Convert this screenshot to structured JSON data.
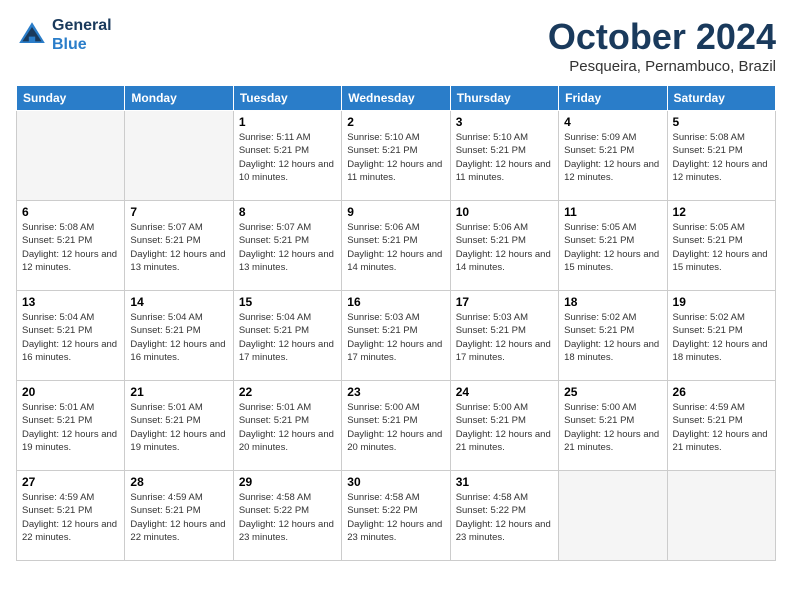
{
  "header": {
    "logo_line1": "General",
    "logo_line2": "Blue",
    "month": "October 2024",
    "location": "Pesqueira, Pernambuco, Brazil"
  },
  "weekdays": [
    "Sunday",
    "Monday",
    "Tuesday",
    "Wednesday",
    "Thursday",
    "Friday",
    "Saturday"
  ],
  "weeks": [
    [
      {
        "day": "",
        "sunrise": "",
        "sunset": "",
        "daylight": "",
        "empty": true
      },
      {
        "day": "",
        "sunrise": "",
        "sunset": "",
        "daylight": "",
        "empty": true
      },
      {
        "day": "1",
        "sunrise": "Sunrise: 5:11 AM",
        "sunset": "Sunset: 5:21 PM",
        "daylight": "Daylight: 12 hours and 10 minutes.",
        "empty": false
      },
      {
        "day": "2",
        "sunrise": "Sunrise: 5:10 AM",
        "sunset": "Sunset: 5:21 PM",
        "daylight": "Daylight: 12 hours and 11 minutes.",
        "empty": false
      },
      {
        "day": "3",
        "sunrise": "Sunrise: 5:10 AM",
        "sunset": "Sunset: 5:21 PM",
        "daylight": "Daylight: 12 hours and 11 minutes.",
        "empty": false
      },
      {
        "day": "4",
        "sunrise": "Sunrise: 5:09 AM",
        "sunset": "Sunset: 5:21 PM",
        "daylight": "Daylight: 12 hours and 12 minutes.",
        "empty": false
      },
      {
        "day": "5",
        "sunrise": "Sunrise: 5:08 AM",
        "sunset": "Sunset: 5:21 PM",
        "daylight": "Daylight: 12 hours and 12 minutes.",
        "empty": false
      }
    ],
    [
      {
        "day": "6",
        "sunrise": "Sunrise: 5:08 AM",
        "sunset": "Sunset: 5:21 PM",
        "daylight": "Daylight: 12 hours and 12 minutes.",
        "empty": false
      },
      {
        "day": "7",
        "sunrise": "Sunrise: 5:07 AM",
        "sunset": "Sunset: 5:21 PM",
        "daylight": "Daylight: 12 hours and 13 minutes.",
        "empty": false
      },
      {
        "day": "8",
        "sunrise": "Sunrise: 5:07 AM",
        "sunset": "Sunset: 5:21 PM",
        "daylight": "Daylight: 12 hours and 13 minutes.",
        "empty": false
      },
      {
        "day": "9",
        "sunrise": "Sunrise: 5:06 AM",
        "sunset": "Sunset: 5:21 PM",
        "daylight": "Daylight: 12 hours and 14 minutes.",
        "empty": false
      },
      {
        "day": "10",
        "sunrise": "Sunrise: 5:06 AM",
        "sunset": "Sunset: 5:21 PM",
        "daylight": "Daylight: 12 hours and 14 minutes.",
        "empty": false
      },
      {
        "day": "11",
        "sunrise": "Sunrise: 5:05 AM",
        "sunset": "Sunset: 5:21 PM",
        "daylight": "Daylight: 12 hours and 15 minutes.",
        "empty": false
      },
      {
        "day": "12",
        "sunrise": "Sunrise: 5:05 AM",
        "sunset": "Sunset: 5:21 PM",
        "daylight": "Daylight: 12 hours and 15 minutes.",
        "empty": false
      }
    ],
    [
      {
        "day": "13",
        "sunrise": "Sunrise: 5:04 AM",
        "sunset": "Sunset: 5:21 PM",
        "daylight": "Daylight: 12 hours and 16 minutes.",
        "empty": false
      },
      {
        "day": "14",
        "sunrise": "Sunrise: 5:04 AM",
        "sunset": "Sunset: 5:21 PM",
        "daylight": "Daylight: 12 hours and 16 minutes.",
        "empty": false
      },
      {
        "day": "15",
        "sunrise": "Sunrise: 5:04 AM",
        "sunset": "Sunset: 5:21 PM",
        "daylight": "Daylight: 12 hours and 17 minutes.",
        "empty": false
      },
      {
        "day": "16",
        "sunrise": "Sunrise: 5:03 AM",
        "sunset": "Sunset: 5:21 PM",
        "daylight": "Daylight: 12 hours and 17 minutes.",
        "empty": false
      },
      {
        "day": "17",
        "sunrise": "Sunrise: 5:03 AM",
        "sunset": "Sunset: 5:21 PM",
        "daylight": "Daylight: 12 hours and 17 minutes.",
        "empty": false
      },
      {
        "day": "18",
        "sunrise": "Sunrise: 5:02 AM",
        "sunset": "Sunset: 5:21 PM",
        "daylight": "Daylight: 12 hours and 18 minutes.",
        "empty": false
      },
      {
        "day": "19",
        "sunrise": "Sunrise: 5:02 AM",
        "sunset": "Sunset: 5:21 PM",
        "daylight": "Daylight: 12 hours and 18 minutes.",
        "empty": false
      }
    ],
    [
      {
        "day": "20",
        "sunrise": "Sunrise: 5:01 AM",
        "sunset": "Sunset: 5:21 PM",
        "daylight": "Daylight: 12 hours and 19 minutes.",
        "empty": false
      },
      {
        "day": "21",
        "sunrise": "Sunrise: 5:01 AM",
        "sunset": "Sunset: 5:21 PM",
        "daylight": "Daylight: 12 hours and 19 minutes.",
        "empty": false
      },
      {
        "day": "22",
        "sunrise": "Sunrise: 5:01 AM",
        "sunset": "Sunset: 5:21 PM",
        "daylight": "Daylight: 12 hours and 20 minutes.",
        "empty": false
      },
      {
        "day": "23",
        "sunrise": "Sunrise: 5:00 AM",
        "sunset": "Sunset: 5:21 PM",
        "daylight": "Daylight: 12 hours and 20 minutes.",
        "empty": false
      },
      {
        "day": "24",
        "sunrise": "Sunrise: 5:00 AM",
        "sunset": "Sunset: 5:21 PM",
        "daylight": "Daylight: 12 hours and 21 minutes.",
        "empty": false
      },
      {
        "day": "25",
        "sunrise": "Sunrise: 5:00 AM",
        "sunset": "Sunset: 5:21 PM",
        "daylight": "Daylight: 12 hours and 21 minutes.",
        "empty": false
      },
      {
        "day": "26",
        "sunrise": "Sunrise: 4:59 AM",
        "sunset": "Sunset: 5:21 PM",
        "daylight": "Daylight: 12 hours and 21 minutes.",
        "empty": false
      }
    ],
    [
      {
        "day": "27",
        "sunrise": "Sunrise: 4:59 AM",
        "sunset": "Sunset: 5:21 PM",
        "daylight": "Daylight: 12 hours and 22 minutes.",
        "empty": false
      },
      {
        "day": "28",
        "sunrise": "Sunrise: 4:59 AM",
        "sunset": "Sunset: 5:21 PM",
        "daylight": "Daylight: 12 hours and 22 minutes.",
        "empty": false
      },
      {
        "day": "29",
        "sunrise": "Sunrise: 4:58 AM",
        "sunset": "Sunset: 5:22 PM",
        "daylight": "Daylight: 12 hours and 23 minutes.",
        "empty": false
      },
      {
        "day": "30",
        "sunrise": "Sunrise: 4:58 AM",
        "sunset": "Sunset: 5:22 PM",
        "daylight": "Daylight: 12 hours and 23 minutes.",
        "empty": false
      },
      {
        "day": "31",
        "sunrise": "Sunrise: 4:58 AM",
        "sunset": "Sunset: 5:22 PM",
        "daylight": "Daylight: 12 hours and 23 minutes.",
        "empty": false
      },
      {
        "day": "",
        "sunrise": "",
        "sunset": "",
        "daylight": "",
        "empty": true
      },
      {
        "day": "",
        "sunrise": "",
        "sunset": "",
        "daylight": "",
        "empty": true
      }
    ]
  ]
}
